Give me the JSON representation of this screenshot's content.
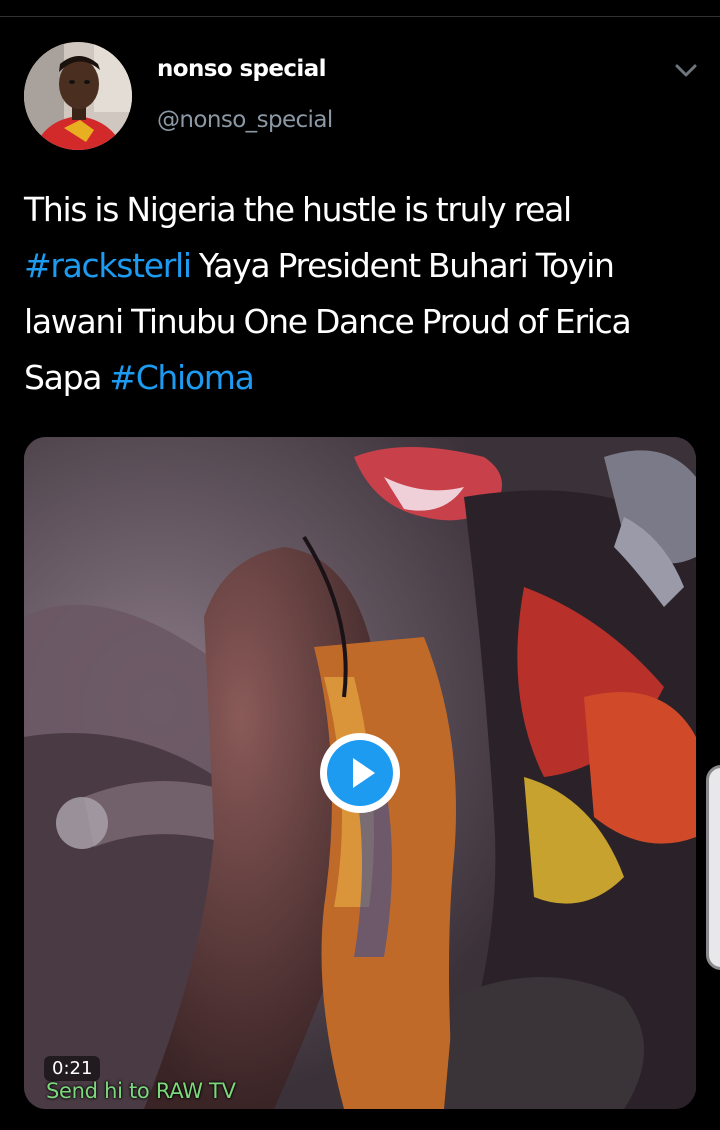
{
  "author": {
    "name": "nonso special",
    "handle": "@nonso_special"
  },
  "tweet": {
    "line1": "This is Nigeria the hustle is truly real",
    "hashtag1": "#racksterli",
    "line2_rest": " Yaya President Buhari Toyin",
    "line3": "lawani Tinubu One Dance Proud of Erica",
    "line4_start": "Sapa ",
    "hashtag2": "#Chioma"
  },
  "media": {
    "duration": "0:21",
    "watermark": "Send hi to RAW TV"
  },
  "colors": {
    "background": "#000000",
    "text": "#ffffff",
    "secondary_text": "#8b98a5",
    "link": "#1d9bf0",
    "watermark": "#7dd87d"
  },
  "icons": {
    "menu": "chevron-down-icon",
    "play": "play-icon"
  }
}
